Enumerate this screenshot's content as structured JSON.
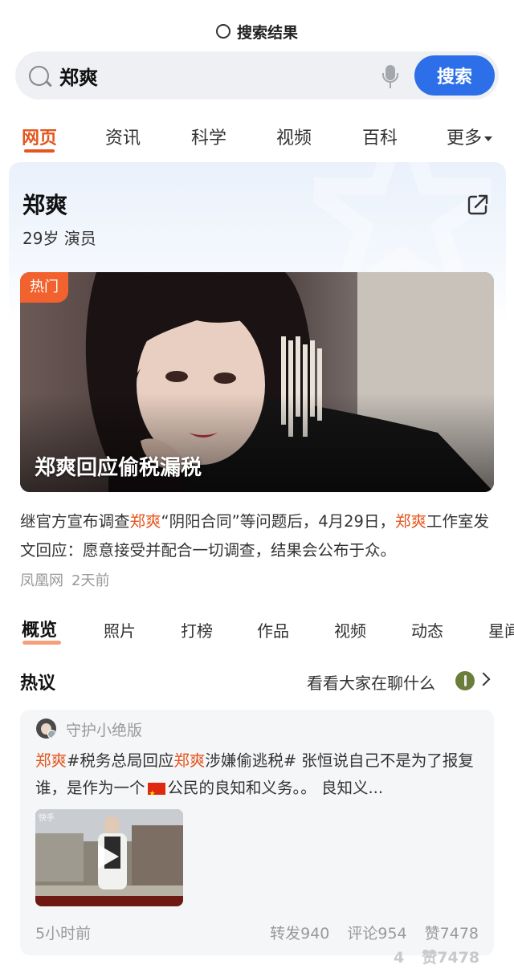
{
  "header": {
    "title": "搜索结果"
  },
  "search": {
    "query": "郑爽",
    "button_label": "搜索"
  },
  "nav_tabs": [
    {
      "label": "网页",
      "active": true
    },
    {
      "label": "资讯"
    },
    {
      "label": "科学"
    },
    {
      "label": "视频"
    },
    {
      "label": "百科"
    },
    {
      "label": "更多"
    }
  ],
  "entity": {
    "name": "郑爽",
    "meta": "29岁 演员"
  },
  "hero": {
    "badge": "热门",
    "title": "郑爽回应偷税漏税"
  },
  "description": {
    "segments": [
      "继官方宣布调查",
      "郑爽",
      "“阴阳合同”等问题后，4月29日，",
      "郑爽",
      "工作室发文回应：愿意接受并配合一切调查，结果会公布于众。"
    ],
    "source": "凤凰网",
    "time": "2天前"
  },
  "sub_tabs": [
    {
      "label": "概览",
      "active": true
    },
    {
      "label": "照片"
    },
    {
      "label": "打榜"
    },
    {
      "label": "作品"
    },
    {
      "label": "视频"
    },
    {
      "label": "动态"
    },
    {
      "label": "星闻"
    }
  ],
  "discussion": {
    "title": "热议",
    "link_label": "看看大家在聊什么"
  },
  "post": {
    "author": "守护小绝版",
    "text_segments": [
      "郑爽",
      "#税务总局回应",
      "郑爽",
      "涉嫌偷逃税# 张恒说自己不是为了报复谁，是作为一个",
      "公民的良知和义务。。 良知义..."
    ],
    "video_label": "快手",
    "time": "5小时前",
    "stats": {
      "reposts": "转发940",
      "comments": "评论954",
      "likes": "赞7478"
    }
  },
  "ghost_overlay": {
    "count": "4",
    "likes": "赞7478"
  },
  "colors": {
    "accent": "#e4561f",
    "brand_blue": "#2c6fe8",
    "hot_badge": "#f2622e"
  }
}
